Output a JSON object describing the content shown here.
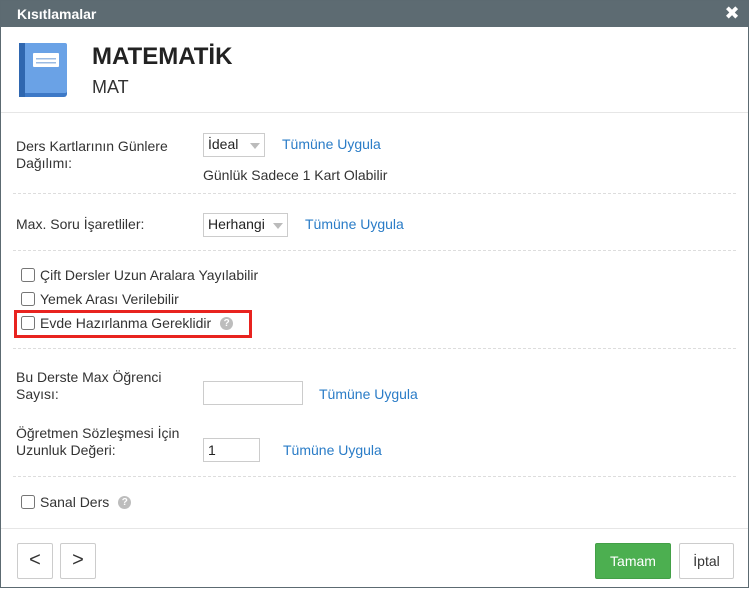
{
  "dialog": {
    "title": "Kısıtlamalar",
    "close_glyph": "✖"
  },
  "course": {
    "name": "MATEMATİK",
    "code": "MAT",
    "icon": "book-icon"
  },
  "distribution": {
    "label": "Ders Kartlarının Günlere Dağılımı:",
    "selected": "İdeal",
    "apply_label": "Tümüne Uygula",
    "note": "Günlük Sadece 1 Kart Olabilir"
  },
  "max_question": {
    "label": "Max. Soru İşaretliler:",
    "selected": "Herhangi",
    "apply_label": "Tümüne Uygula"
  },
  "checkboxes": [
    {
      "label": "Çift Dersler Uzun Aralara Yayılabilir",
      "checked": false
    },
    {
      "label": "Yemek Arası Verilebilir",
      "checked": false
    },
    {
      "label": "Evde Hazırlanma Gereklidir",
      "checked": false
    }
  ],
  "max_students": {
    "label": "Bu Derste Max Öğrenci Sayısı:",
    "value": "",
    "apply_label": "Tümüne Uygula"
  },
  "contract_length": {
    "label": "Öğretmen Sözleşmesi İçin Uzunluk Değeri:",
    "value": "1",
    "apply_label": "Tümüne Uygula"
  },
  "virtual": {
    "label": "Sanal Ders",
    "checked": false
  },
  "help_glyph": "?",
  "footer": {
    "prev_label": "<",
    "next_label": ">",
    "ok_label": "Tamam",
    "cancel_label": "İptal"
  },
  "colors": {
    "titlebar": "#5d6b72",
    "link": "#2a7cc7",
    "ok": "#4caf50",
    "highlight": "#e8231f"
  }
}
